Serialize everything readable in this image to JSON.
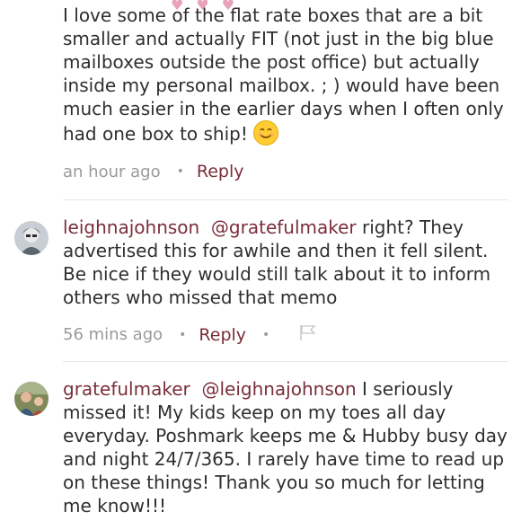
{
  "comments": [
    {
      "text": "I love some of the flat rate boxes that are a bit smaller and actually FIT (not just in the big blue mailboxes outside the post office) but actually inside my personal mailbox. ; ) would have been much easier in the earlier days when I often only had one box to ship!",
      "time": "an hour ago",
      "reply": "Reply",
      "emoji": "smiling-face-icon"
    },
    {
      "user": "leighnajohnson",
      "mention": "@gratefulmaker",
      "text": "right? They advertised this for awhile and then it fell silent. Be nice if they would still talk about it to inform others who missed that memo",
      "time": "56 mins ago",
      "reply": "Reply",
      "flag_icon": "flag-icon"
    },
    {
      "user": "gratefulmaker",
      "mention": "@leighnajohnson",
      "text": "I seriously missed it! My kids keep on my toes all day everyday. Poshmark keeps me & Hubby busy day and night 24/7/365. I rarely have time to read up on these things! Thank you so much for letting me know!!!"
    }
  ],
  "colors": {
    "accent": "#7a2e3b",
    "meta": "#9a9a9a",
    "divider": "#e6e6e6"
  }
}
